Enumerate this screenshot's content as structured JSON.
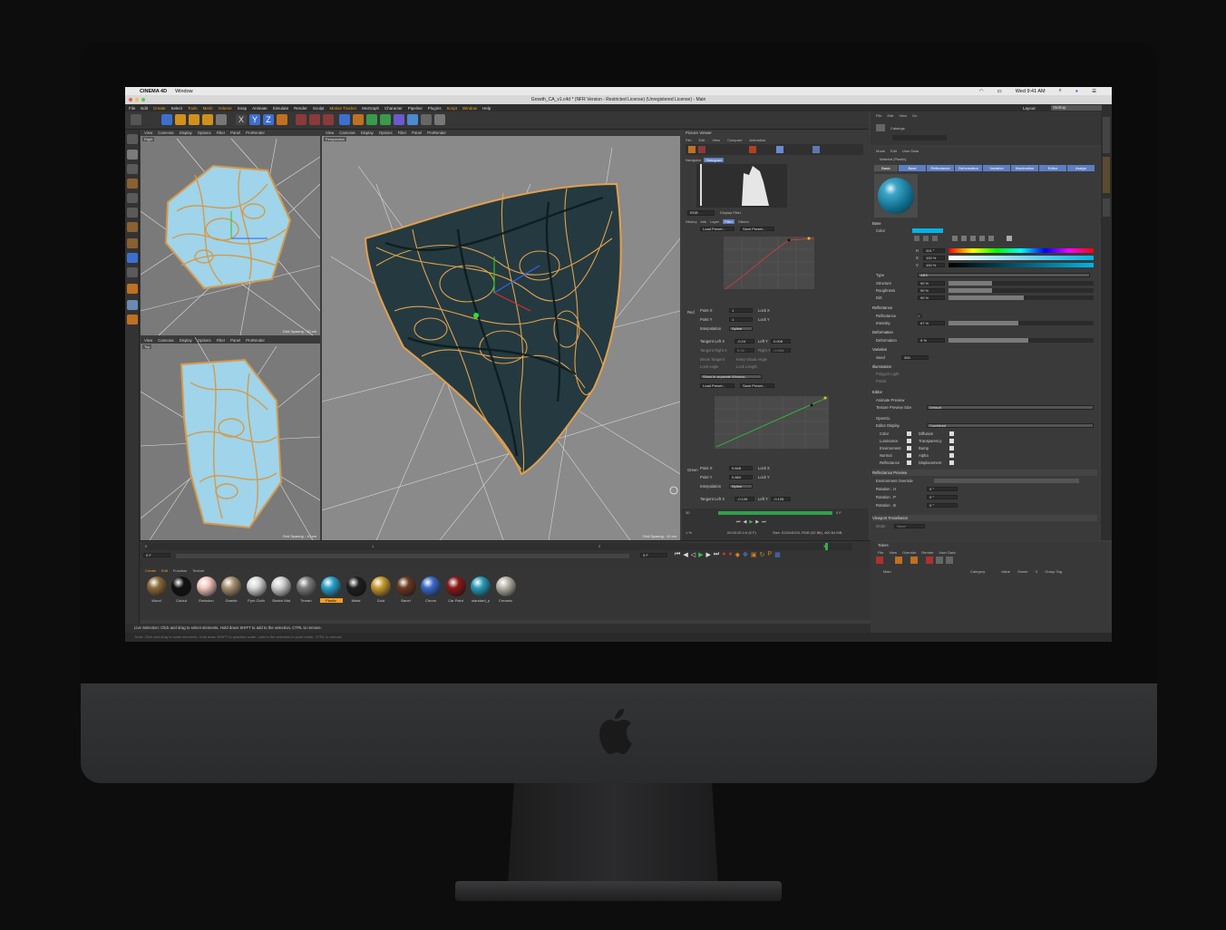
{
  "mac_menubar": {
    "app_name": "CINEMA 4D",
    "items": [
      "Window"
    ],
    "clock": "Wed 9:41 AM"
  },
  "window": {
    "title": "Growth_CA_v1.c4d * (NFR Version - Restricted License) (Unregistered License) - Main"
  },
  "main_menu": [
    "File",
    "Edit",
    "Create",
    "Select",
    "Tools",
    "Mesh",
    "Volume",
    "Snap",
    "Animate",
    "Simulate",
    "Render",
    "Sculpt",
    "Motion Tracker",
    "MoGraph",
    "Character",
    "Pipeline",
    "Plugins",
    "Script",
    "Window",
    "Help"
  ],
  "viewport_menu": [
    "View",
    "Cameras",
    "Display",
    "Options",
    "Filter",
    "Panel",
    "ProRender"
  ],
  "viewports": {
    "right": {
      "label": "Right",
      "grid": "Grid Spacing : 10 cm"
    },
    "top": {
      "label": "Top",
      "grid": "Grid Spacing : 10 cm"
    },
    "perspective": {
      "label": "Perspective",
      "grid": "Grid Spacing : 10 cm"
    }
  },
  "picture_viewer": {
    "title": "Picture Viewer",
    "menu": [
      "File",
      "Edit",
      "View",
      "Compare",
      "Animation"
    ],
    "nav_tabs": [
      "Navigator",
      "Histogram"
    ],
    "mode": "RGB",
    "display_filter": "Display Filter",
    "tabs": [
      "History",
      "Info",
      "Layer",
      "Filter",
      "Stereo"
    ],
    "load_preset": "Load Preset...",
    "save_preset": "Save Preset...",
    "red": {
      "channel": "Red",
      "point_x_label": "Point X",
      "point_x": "1",
      "point_y_label": "Point Y",
      "point_y": "1",
      "lock_x": "Lock X",
      "lock_y": "Lock Y",
      "interpolation_label": "Interpolation",
      "interpolation": "Spline",
      "tangent_left_x_label": "Tangent Left X",
      "tangent_left_x": "-0.24",
      "left_y_label": "Left Y",
      "left_y": "0.008",
      "tangent_right_x_label": "Tangent Right X",
      "tangent_right_x": "0.24",
      "right_y_label": "Right Y",
      "right_y": "-0.008",
      "break_tangent": "Break Tangent",
      "keep_visual_angle": "Keep Visual Angle",
      "lock_angle": "Lock Angle",
      "lock_length": "Lock Length",
      "show_separate": "Show in separate Window..."
    },
    "green": {
      "channel": "Green",
      "point_x_label": "Point X",
      "point_x": "0.848",
      "point_y_label": "Point Y",
      "point_y": "0.884",
      "lock_x": "Lock X",
      "lock_y": "Lock Y",
      "interpolation_label": "Interpolation",
      "interpolation": "Spline",
      "tangent_left_x_label": "Tangent Left X",
      "tangent_left_x": "-0.126",
      "left_y_label": "Left Y",
      "left_y": "-0.126"
    },
    "footer": {
      "frame_start": "30",
      "frame_end": "0 F",
      "zoom": "1 %",
      "time": "00:00:05 1/4 (0 F)",
      "size": "Size: 5120x5120, RGB (32 Bit), 400.64 MB,"
    }
  },
  "content_browser": {
    "menu": [
      "File",
      "Edit",
      "View",
      "Go"
    ],
    "catalog": "Catalogs"
  },
  "attributes": {
    "menu": [
      "Mode",
      "Edit",
      "User Data"
    ],
    "material": "Material [Plastic]",
    "tabs": [
      "Basic",
      "Base",
      "Reflectance",
      "Deformation",
      "Variation",
      "Illumination",
      "Editor",
      "Assign"
    ],
    "base_section": "Base",
    "color_label": "Color",
    "h_label": "H",
    "h_value": "201 °",
    "s_label": "S",
    "s_value": "100 %",
    "v_label": "V",
    "v_value": "100 %",
    "type_label": "Type",
    "type_value": "ABS",
    "structure_label": "Structure",
    "structure_value": "90 %",
    "roughness_label": "Roughness",
    "roughness_value": "90 %",
    "dirt_label": "Dirt",
    "dirt_value": "90 %",
    "reflectance_section": "Reflectance",
    "reflectance_label": "Reflectance",
    "intensity_label": "Intensity",
    "intensity_value": "67 %",
    "deformation_section": "Deformation",
    "deformation_label": "Deformation",
    "deformation_value": "5 %",
    "variation_section": "Variation",
    "seed_label": "Seed",
    "seed_value": "300",
    "illumination_section": "Illumination",
    "polygon_light": "Polygon Light",
    "portal": "Portal",
    "editor_section": "Editor",
    "animate_preview": "Animate Preview",
    "texture_preview_size": "Texture Preview Size",
    "texture_preview_value": "Default",
    "opengl": "OpenGL",
    "editor_display": "Editor Display",
    "editor_display_value": "Combined",
    "channels_left": [
      "Color",
      "Luminance",
      "Environment",
      "Normal",
      "Reflectance"
    ],
    "channels_right": [
      "Diffusion",
      "Transparency",
      "Bump",
      "Alpha",
      "Displacement"
    ],
    "reflectance_preview": "Reflectance Preview",
    "environment_override": "Environment Override",
    "rotation_h": "Rotation . H",
    "rotation_p": "Rotation . P",
    "rotation_b": "Rotation . B",
    "rotation_value": "0 °",
    "viewport_tessellation": "Viewport Tessellation",
    "mode_label": "Mode",
    "mode_value": "None"
  },
  "takes": {
    "title": "Takes",
    "menu": [
      "File",
      "View",
      "Override",
      "Render",
      "User Data"
    ],
    "main": "Main",
    "columns": [
      "Category",
      "Value",
      "Owner",
      "V",
      "Group Tag"
    ]
  },
  "layout": {
    "label": "Layout:",
    "value": "Startup"
  },
  "timeline": {
    "start": "0 F",
    "end": "3 F",
    "current": "0 F",
    "ticks": [
      "0",
      "1",
      "2",
      "3"
    ]
  },
  "material_manager": {
    "menu": [
      "Create",
      "Edit",
      "Function",
      "Texture"
    ],
    "materials": [
      {
        "name": "Wood",
        "color": "#8a6a3a"
      },
      {
        "name": "Cutout",
        "color": "#111111"
      },
      {
        "name": "Emission",
        "color": "#f4c8c0"
      },
      {
        "name": "Granite",
        "color": "#a89070"
      },
      {
        "name": "Pyro Cloth",
        "color": "#d8d8d8"
      },
      {
        "name": "Sketch Mat",
        "color": "#cfcfcf"
      },
      {
        "name": "Terrain",
        "color": "#7c7c7c"
      },
      {
        "name": "Plastic",
        "color": "#2aa0c8"
      },
      {
        "name": "Metal",
        "color": "#1e1e1e"
      },
      {
        "name": "Gold",
        "color": "#c89a30"
      },
      {
        "name": "Banel",
        "color": "#6a3a20"
      },
      {
        "name": "Chrom",
        "color": "#3a6ac8"
      },
      {
        "name": "Car Paint",
        "color": "#8a1818"
      },
      {
        "name": "standard_p",
        "color": "#2a9ab8"
      },
      {
        "name": "Ceramic",
        "color": "#b8b4a8"
      }
    ]
  },
  "status": {
    "line1": "Live Selection: Click and drag to select elements. Hold down SHIFT to add to the selection, CTRL to remove.",
    "line2": "Tools: Click and drag to scale elements. Hold down SHIFT to quantize scale / add to the selection in point mode, CTRL to remove."
  },
  "colors": {
    "accent_orange": "#f0a020",
    "selected_blue": "#5d7ec2",
    "plastic_color": "#00b4e6"
  }
}
